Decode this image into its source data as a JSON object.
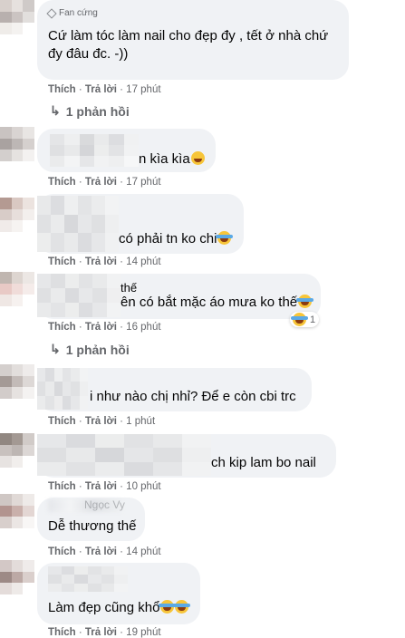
{
  "comments": [
    {
      "badge": "Fan cứng",
      "text": "Cứ làm tóc làm nail cho đẹp đy , tết ở nhà chứ đy đâu đc. -))",
      "like": "Thích",
      "reply": "Trả lời",
      "time": "17 phút",
      "replies": "1 phản hồi"
    },
    {
      "text": "n kìa kìa",
      "like": "Thích",
      "reply": "Trả lời",
      "time": "17 phút"
    },
    {
      "text": "có phải tn ko chi",
      "like": "Thích",
      "reply": "Trả lời",
      "time": "14 phút"
    },
    {
      "text_top": "thế",
      "text": "ên có bắt mặc áo mưa ko thế",
      "like": "Thích",
      "reply": "Trả lời",
      "time": "16 phút",
      "reaction_count": "1",
      "replies": "1 phản hồi"
    },
    {
      "text": "i như nào chị nhỉ? Để e còn cbi trc",
      "like": "Thích",
      "reply": "Trả lời",
      "time": "1 phút"
    },
    {
      "text": "ch kip lam bo nail",
      "like": "Thích",
      "reply": "Trả lời",
      "time": "10 phút"
    },
    {
      "text_top": "Ngọc Vy",
      "text": "Dễ thương thế",
      "like": "Thích",
      "reply": "Trả lời",
      "time": "14 phút"
    },
    {
      "text": "Làm đẹp cũng khổ",
      "like": "Thích",
      "reply": "Trả lời",
      "time": "19 phút"
    }
  ],
  "icons": {
    "badge": "diamond-icon",
    "reply_arrow": "reply-arrow-icon",
    "emoji_laugh": "laughing-emoji",
    "emoji_tears": "tears-of-joy-emoji"
  },
  "colors": {
    "bubble": "#f0f2f5",
    "meta_text": "#65676b",
    "emoji": "#f7c539"
  }
}
